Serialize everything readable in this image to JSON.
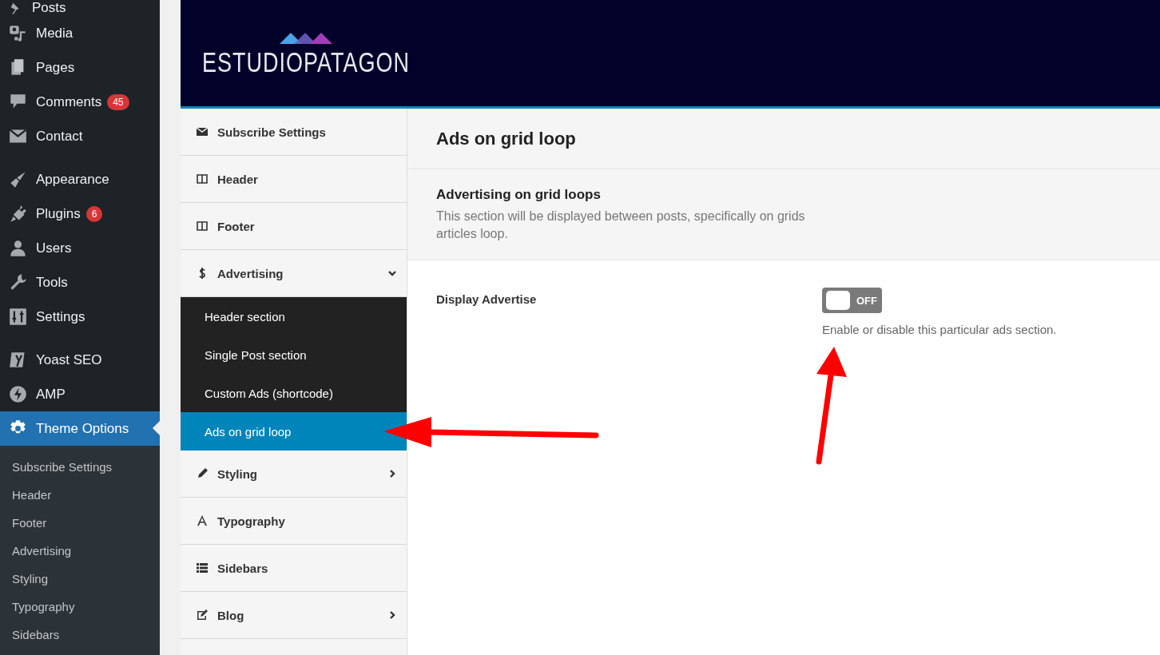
{
  "admin_menu": {
    "groups": [
      [
        {
          "label": "Posts",
          "selected": false
        },
        {
          "label": "Media",
          "selected": false
        },
        {
          "label": "Pages",
          "selected": false
        },
        {
          "label": "Comments",
          "badge": "45",
          "selected": false
        },
        {
          "label": "Contact",
          "selected": false
        }
      ],
      [
        {
          "label": "Appearance",
          "selected": false
        },
        {
          "label": "Plugins",
          "badge": "6",
          "selected": false
        },
        {
          "label": "Users",
          "selected": false
        },
        {
          "label": "Tools",
          "selected": false
        },
        {
          "label": "Settings",
          "selected": false
        }
      ],
      [
        {
          "label": "Yoast SEO",
          "selected": false
        },
        {
          "label": "AMP",
          "selected": false
        },
        {
          "label": "Theme Options",
          "selected": true,
          "children": [
            {
              "label": "Subscribe Settings"
            },
            {
              "label": "Header"
            },
            {
              "label": "Footer"
            },
            {
              "label": "Advertising"
            },
            {
              "label": "Styling"
            },
            {
              "label": "Typography"
            },
            {
              "label": "Sidebars"
            }
          ]
        }
      ]
    ]
  },
  "brand": {
    "name": "ESTUDIOPATAGON"
  },
  "options_nav": [
    {
      "label": "Subscribe Settings"
    },
    {
      "label": "Header"
    },
    {
      "label": "Footer"
    },
    {
      "label": "Advertising",
      "expanded": true,
      "children": [
        {
          "label": "Header section",
          "selected": false
        },
        {
          "label": "Single Post section",
          "selected": false
        },
        {
          "label": "Custom Ads (shortcode)",
          "selected": false
        },
        {
          "label": "Ads on grid loop",
          "selected": true
        }
      ]
    },
    {
      "label": "Styling",
      "expanded": false
    },
    {
      "label": "Typography"
    },
    {
      "label": "Sidebars"
    },
    {
      "label": "Blog",
      "expanded": false
    }
  ],
  "content": {
    "title": "Ads on grid loop",
    "section": {
      "heading": "Advertising on grid loops",
      "description": "This section will be displayed between posts, specifically on grids articles loop."
    },
    "fields": [
      {
        "label": "Display Advertise",
        "toggle": {
          "on": false,
          "text": "OFF"
        },
        "hint": "Enable or disable this particular ads section."
      }
    ]
  }
}
